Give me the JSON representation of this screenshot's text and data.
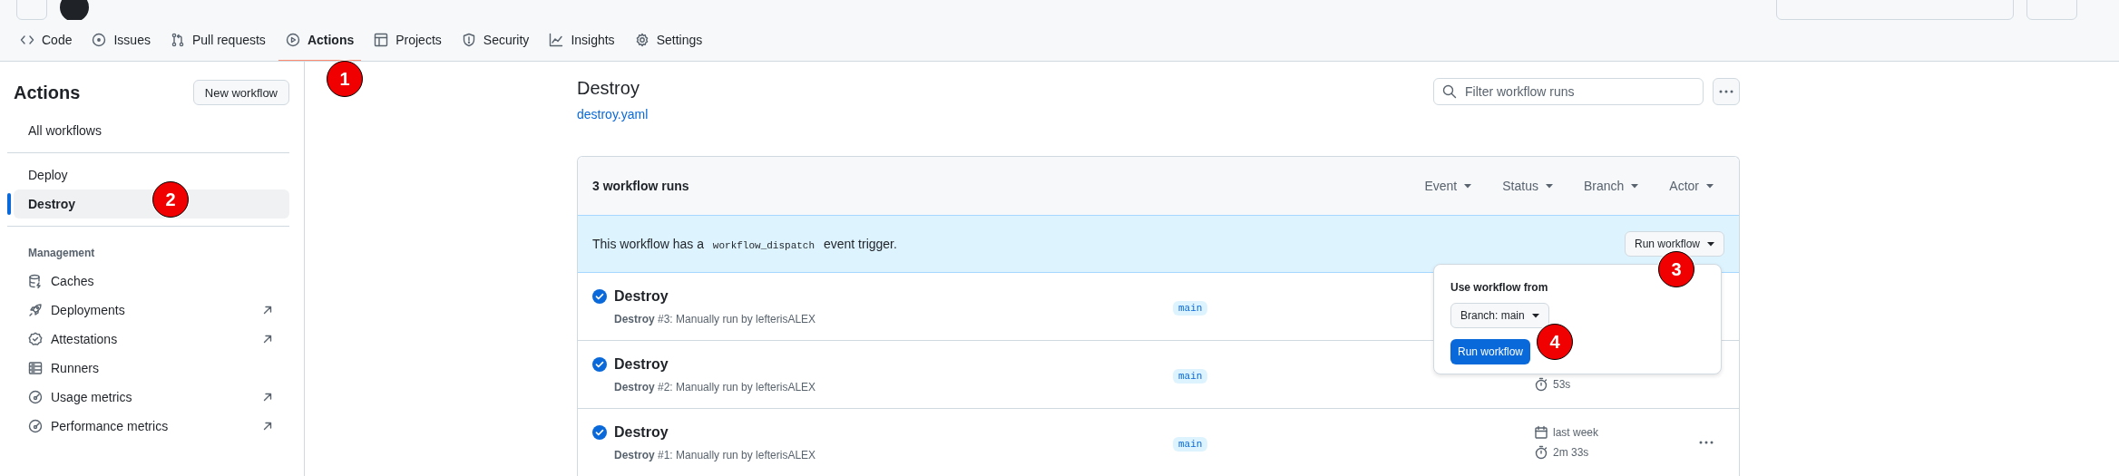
{
  "header": {
    "tabs": [
      {
        "label": "Code",
        "selected": false
      },
      {
        "label": "Issues",
        "selected": false
      },
      {
        "label": "Pull requests",
        "selected": false
      },
      {
        "label": "Actions",
        "selected": true
      },
      {
        "label": "Projects",
        "selected": false
      },
      {
        "label": "Security",
        "selected": false
      },
      {
        "label": "Insights",
        "selected": false
      },
      {
        "label": "Settings",
        "selected": false
      }
    ]
  },
  "sidebar": {
    "title": "Actions",
    "new_button": "New workflow",
    "top_items": [
      {
        "label": "All workflows",
        "selected": false
      }
    ],
    "workflows": [
      {
        "label": "Deploy",
        "selected": false
      },
      {
        "label": "Destroy",
        "selected": true
      }
    ],
    "management": {
      "heading": "Management",
      "items": [
        {
          "label": "Caches",
          "external": false
        },
        {
          "label": "Deployments",
          "external": true
        },
        {
          "label": "Attestations",
          "external": true
        },
        {
          "label": "Runners",
          "external": false
        },
        {
          "label": "Usage metrics",
          "external": true
        },
        {
          "label": "Performance metrics",
          "external": true
        }
      ]
    }
  },
  "main": {
    "title": "Destroy",
    "file_link": "destroy.yaml",
    "filter": {
      "placeholder": "Filter workflow runs"
    },
    "runs_count": "3 workflow runs",
    "filters": [
      "Event",
      "Status",
      "Branch",
      "Actor"
    ],
    "banner": {
      "text_before": "This workflow has a",
      "code": "workflow_dispatch",
      "text_after": "event trigger.",
      "button": "Run workflow"
    },
    "runs": [
      {
        "kind": "success",
        "title": "Destroy",
        "description": "**Destroy** #3: Manually run by lefterisALEX",
        "branch": "main",
        "more_button": false
      },
      {
        "kind": "success",
        "title": "Destroy",
        "description": "**Destroy** #2: Manually run by lefterisALEX",
        "branch": "main",
        "duration": "53s",
        "more_button": false
      },
      {
        "kind": "success",
        "title": "Destroy",
        "description": "**Destroy** #1: Manually run by lefterisALEX",
        "branch": "main",
        "date": "last week",
        "duration": "2m 33s",
        "more_button": true
      }
    ],
    "popover": {
      "heading": "Use workflow from",
      "branch_button": "Branch: main",
      "run_button": "Run workflow"
    }
  },
  "annotations": [
    {
      "label": "1"
    },
    {
      "label": "2"
    },
    {
      "label": "3"
    },
    {
      "label": "4"
    }
  ]
}
